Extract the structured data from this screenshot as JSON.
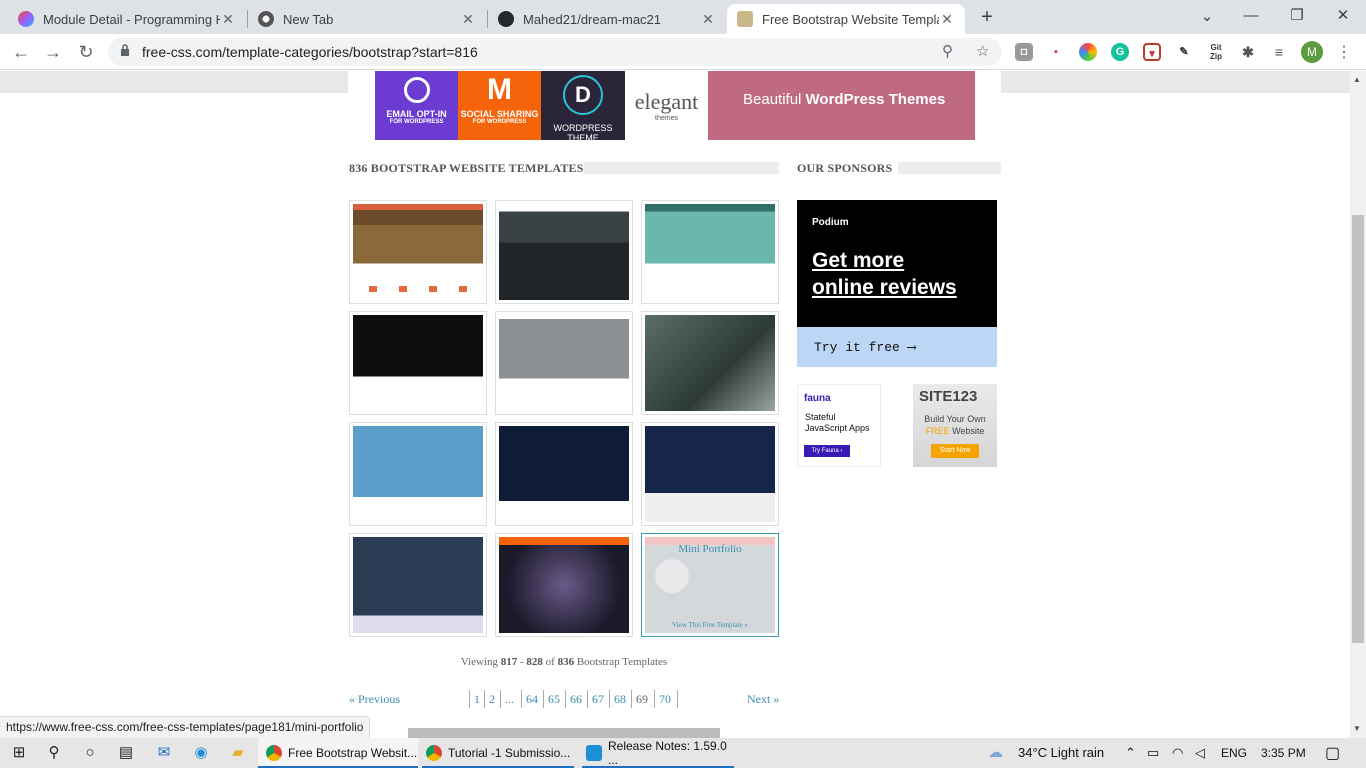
{
  "browser": {
    "tabs": [
      {
        "title": "Module Detail - Programming He",
        "icon": "figma-icon"
      },
      {
        "title": "New Tab",
        "icon": "chrome-icon"
      },
      {
        "title": "Mahed21/dream-mac21",
        "icon": "github-icon"
      },
      {
        "title": "Free Bootstrap Website Template",
        "icon": "css-icon"
      }
    ],
    "url": "free-css.com/template-categories/bootstrap?start=816",
    "avatar_letter": "M",
    "ext_gitzip": "Git Zip"
  },
  "banner": {
    "items": [
      "EMAIL OPT-IN",
      "SOCIAL SHARING",
      "WORDPRESS THEME",
      "elegant"
    ],
    "sub": [
      "FOR WORDPRESS",
      "FOR WORDPRESS",
      "",
      "themes"
    ],
    "text_pre": "Beautiful ",
    "text_bold": "WordPress Themes"
  },
  "main": {
    "heading": "836 BOOTSTRAP WEBSITE TEMPLATES",
    "mini_title": "Mini Portfolio",
    "mini_link": "View This Free Template »",
    "viewing_pre": "Viewing ",
    "viewing_from": "817",
    "viewing_dash": " - ",
    "viewing_to": "828",
    "viewing_of": " of ",
    "viewing_total": "836",
    "viewing_post": " Bootstrap Templates",
    "prev": "« Previous",
    "next": "Next »",
    "pages": [
      "1",
      "2",
      "...",
      "64",
      "65",
      "66",
      "67",
      "68",
      "69",
      "70"
    ],
    "current_page": "69"
  },
  "sidebar": {
    "heading": "OUR SPONSORS",
    "podium_logo": "Podium",
    "podium_line1": "Get more",
    "podium_line2": "online reviews",
    "podium_cta": "Try it free ⟶",
    "fauna_logo": "fauna",
    "fauna_line1": "Stateful",
    "fauna_line2": "JavaScript Apps",
    "fauna_btn": "Try Fauna ›",
    "site_logo": "SITE123",
    "site_line1": "Build Your Own",
    "site_free": "FREE",
    "site_line2": " Website",
    "site_btn": "Start Now"
  },
  "status_url": "https://www.free-css.com/free-css-templates/page181/mini-portfolio",
  "taskbar": {
    "apps": [
      {
        "title": "Free Bootstrap Websit..."
      },
      {
        "title": "Tutorial -1 Submissio..."
      },
      {
        "title": "Release Notes: 1.59.0 ..."
      }
    ],
    "weather": "34°C  Light rain",
    "lang": "ENG",
    "time": "3:35 PM"
  }
}
